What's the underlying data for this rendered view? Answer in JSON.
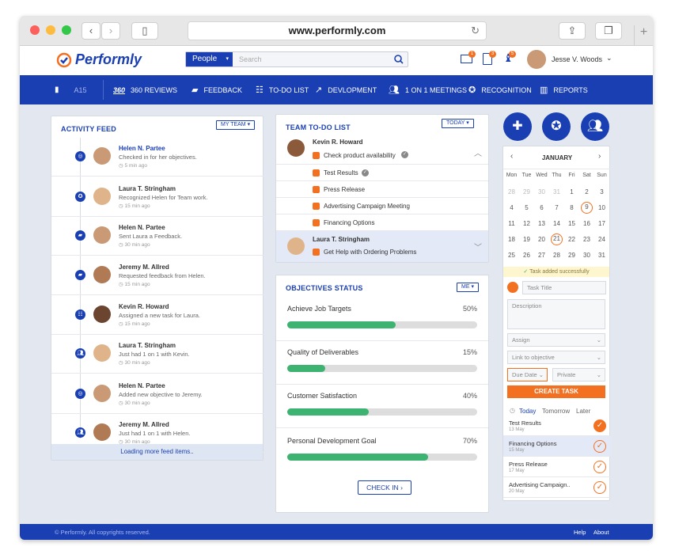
{
  "browser": {
    "url": "www.performly.com"
  },
  "app": {
    "logo": "Performly"
  },
  "search": {
    "scope": "People",
    "placeholder": "Search"
  },
  "header": {
    "user": "Jesse V. Woods",
    "badges": [
      "1",
      "3",
      "5"
    ]
  },
  "nav": {
    "items": [
      "A15",
      "360 REVIEWS",
      "FEEDBACK",
      "TO-DO LIST",
      "DEVLOPMENT",
      "1 ON 1 MEETINGS",
      "RECOGNITION",
      "REPORTS"
    ],
    "badge360": "360"
  },
  "activity": {
    "title": "ACTIVITY FEED",
    "filter": "MY TEAM",
    "loading": "Loading more feed items..",
    "items": [
      {
        "name": "Helen N. Partee",
        "desc": "Checked in for her objectives.",
        "time": "5 min ago"
      },
      {
        "name": "Laura T. Stringham",
        "desc": "Recognized Helen for Team work.",
        "time": "15 min ago"
      },
      {
        "name": "Helen N. Partee",
        "desc": "Sent Laura a Feedback.",
        "time": "30 min ago"
      },
      {
        "name": "Jeremy M. Allred",
        "desc": "Requested feedback from Helen.",
        "time": "15 min ago"
      },
      {
        "name": "Kevin R. Howard",
        "desc": "Assigned a new task for Laura.",
        "time": "15 min ago"
      },
      {
        "name": "Laura T. Stringham",
        "desc": "Just had 1 on 1 with Kevin.",
        "time": "30 min ago"
      },
      {
        "name": "Helen N. Partee",
        "desc": "Added new objective to Jeremy.",
        "time": "30 min ago"
      },
      {
        "name": "Jeremy M. Allred",
        "desc": "Just had 1 on 1 with Helen.",
        "time": "30 min ago"
      }
    ]
  },
  "todo": {
    "title": "TEAM TO-DO LIST",
    "filter": "TODAY",
    "kevin": {
      "name": "Kevin R. Howard",
      "tasks": [
        "Check product availability",
        "Test Results",
        "Press Release",
        "Advertising Campaign Meeting",
        "Financing Options"
      ]
    },
    "laura": {
      "name": "Laura T. Stringham",
      "tasks": [
        "Get Help with Ordering Problems"
      ]
    }
  },
  "objectives": {
    "title": "OBJECTIVES STATUS",
    "filter": "ME",
    "checkin": "CHECK IN",
    "items": [
      {
        "label": "Achieve Job Targets",
        "pct": "50%",
        "value": 0.57
      },
      {
        "label": "Quality of Deliverables",
        "pct": "15%",
        "value": 0.2
      },
      {
        "label": "Customer Satisfaction",
        "pct": "40%",
        "value": 0.43
      },
      {
        "label": "Personal Development Goal",
        "pct": "70%",
        "value": 0.74
      }
    ]
  },
  "calendar": {
    "month": "JANUARY",
    "days": [
      "Mon",
      "Tue",
      "Wed",
      "Thu",
      "Fri",
      "Sat",
      "Sun"
    ],
    "rows": [
      [
        "28",
        "29",
        "30",
        "31",
        "1",
        "2",
        "3"
      ],
      [
        "4",
        "5",
        "6",
        "7",
        "8",
        "9",
        "10"
      ],
      [
        "11",
        "12",
        "13",
        "14",
        "15",
        "16",
        "17"
      ],
      [
        "18",
        "19",
        "20",
        "21",
        "22",
        "23",
        "24"
      ],
      [
        "25",
        "26",
        "27",
        "28",
        "29",
        "30",
        "31"
      ]
    ]
  },
  "task": {
    "success": "Task added successfully",
    "title_ph": "Task Title",
    "desc_ph": "Description",
    "assign": "Assign",
    "link": "Link to objective",
    "due": "Due Date",
    "privacy": "Private",
    "create": "CREATE TASK",
    "tabs": [
      "Today",
      "Tomorrow",
      "Later"
    ],
    "list": [
      {
        "name": "Test Results",
        "date": "13 May"
      },
      {
        "name": "Financing Options",
        "date": "15 May"
      },
      {
        "name": "Press Release",
        "date": "17 May"
      },
      {
        "name": "Advertising Campaign..",
        "date": "20 May"
      }
    ]
  },
  "footer": {
    "copyright": "© Performly. All copyrights reserved.",
    "help": "Help",
    "about": "About"
  }
}
